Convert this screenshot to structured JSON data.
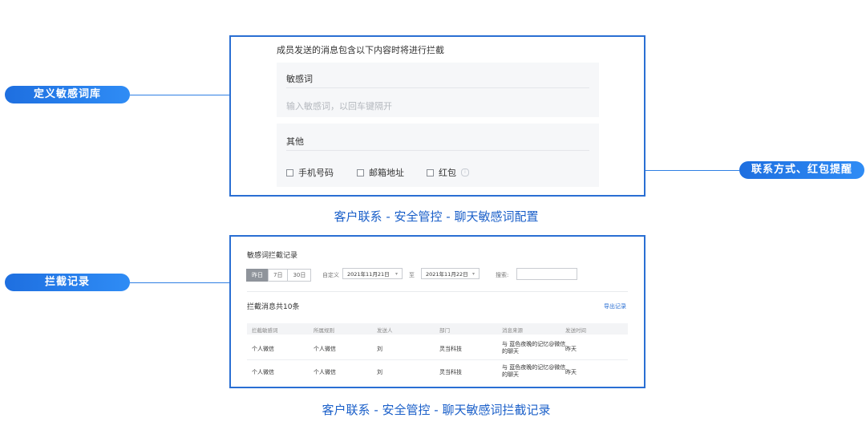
{
  "callouts": {
    "left1": "定义敏感词库",
    "right1": "联系方式、红包提醒",
    "left2": "拦截记录"
  },
  "config_panel": {
    "intro": "成员发送的消息包含以下内容时将进行拦截",
    "sensitive_title": "敏感词",
    "sensitive_placeholder": "输入敏感词，以回车键隔开",
    "other_title": "其他",
    "checkboxes": [
      "手机号码",
      "邮箱地址",
      "红包"
    ]
  },
  "caption1": "客户联系 - 安全管控 - 聊天敏感词配置",
  "records_panel": {
    "title": "敏感词拦截记录",
    "segments": [
      "昨日",
      "7日",
      "30日"
    ],
    "custom_label": "自定义",
    "start_date": "2021年11月21日",
    "to_label": "至",
    "end_date": "2021年11月22日",
    "search_label": "搜索:",
    "count_text": "拦截消息共10条",
    "export_label": "导出记录",
    "headers": [
      "拦截敏感词",
      "所属规则",
      "发送人",
      "部门",
      "消息来源",
      "发送时间"
    ],
    "rows": [
      [
        "个人微信",
        "个人微信",
        "刘",
        "灵当科技",
        "与 蓝色夜晚的记忆@微信 的聊天",
        "昨天"
      ],
      [
        "个人微信",
        "个人微信",
        "刘",
        "灵当科技",
        "与 蓝色夜晚的记忆@微信 的聊天",
        "昨天"
      ]
    ]
  },
  "caption2": "客户联系 - 安全管控 - 聊天敏感词拦截记录",
  "colors": {
    "accent": "#2a6fd3",
    "caption": "#1a5fc9"
  }
}
